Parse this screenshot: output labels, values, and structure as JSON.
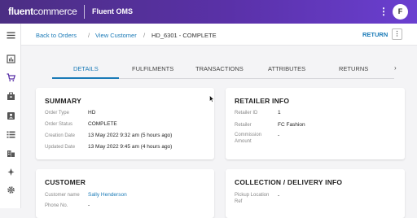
{
  "topbar": {
    "brand_bold": "fluent",
    "brand_thin": "commerce",
    "app_name": "Fluent OMS",
    "menu_glyph": "⋮",
    "avatar_initial": "F"
  },
  "sidebar": {
    "icons": [
      "menu-icon",
      "dashboard-icon",
      "cart-icon",
      "inventory-icon",
      "people-icon",
      "list-icon",
      "store-icon",
      "insights-icon",
      "settings-icon"
    ],
    "active_color": "#5a31a8"
  },
  "breadcrumb": {
    "back_to_orders": "Back to Orders",
    "sep1": "/",
    "view_customer": "View Customer",
    "sep2": "/",
    "current": "HD_6301 - COMPLETE"
  },
  "actions": {
    "return_label": "RETURN",
    "more_glyph": "⋮"
  },
  "tabs": {
    "items": [
      "DETAILS",
      "FULFILMENTS",
      "TRANSACTIONS",
      "ATTRIBUTES",
      "RETURNS"
    ],
    "next_glyph": "›",
    "active": "DETAILS"
  },
  "summary": {
    "title": "SUMMARY",
    "rows": [
      {
        "label": "Order Type",
        "value": "HD"
      },
      {
        "label": "Order Status",
        "value": "COMPLETE"
      },
      {
        "label": "Creation Date",
        "value": "13 May 2022 9:32 am (5 hours ago)"
      },
      {
        "label": "Updated Date",
        "value": "13 May 2022 9:45 am (4 hours ago)"
      }
    ]
  },
  "retailer": {
    "title": "RETAILER INFO",
    "rows": [
      {
        "label": "Retailer ID",
        "value": "1"
      },
      {
        "label": "Retailer",
        "value": "FC Fashion"
      },
      {
        "label": "Commission",
        "label2": "Amount",
        "value": "-"
      }
    ]
  },
  "customer": {
    "title": "CUSTOMER",
    "rows": [
      {
        "label": "Customer name",
        "value": "Sally Henderson"
      },
      {
        "label": "Phone No.",
        "value": "-"
      }
    ]
  },
  "delivery": {
    "title": "COLLECTION / DELIVERY INFO",
    "rows": [
      {
        "label": "Pickup Location",
        "label2": "Ref",
        "value": "-"
      }
    ]
  },
  "colors": {
    "accent": "#1a7ab7",
    "topbar_start": "#4b2e83",
    "topbar_end": "#6a3fd0"
  }
}
